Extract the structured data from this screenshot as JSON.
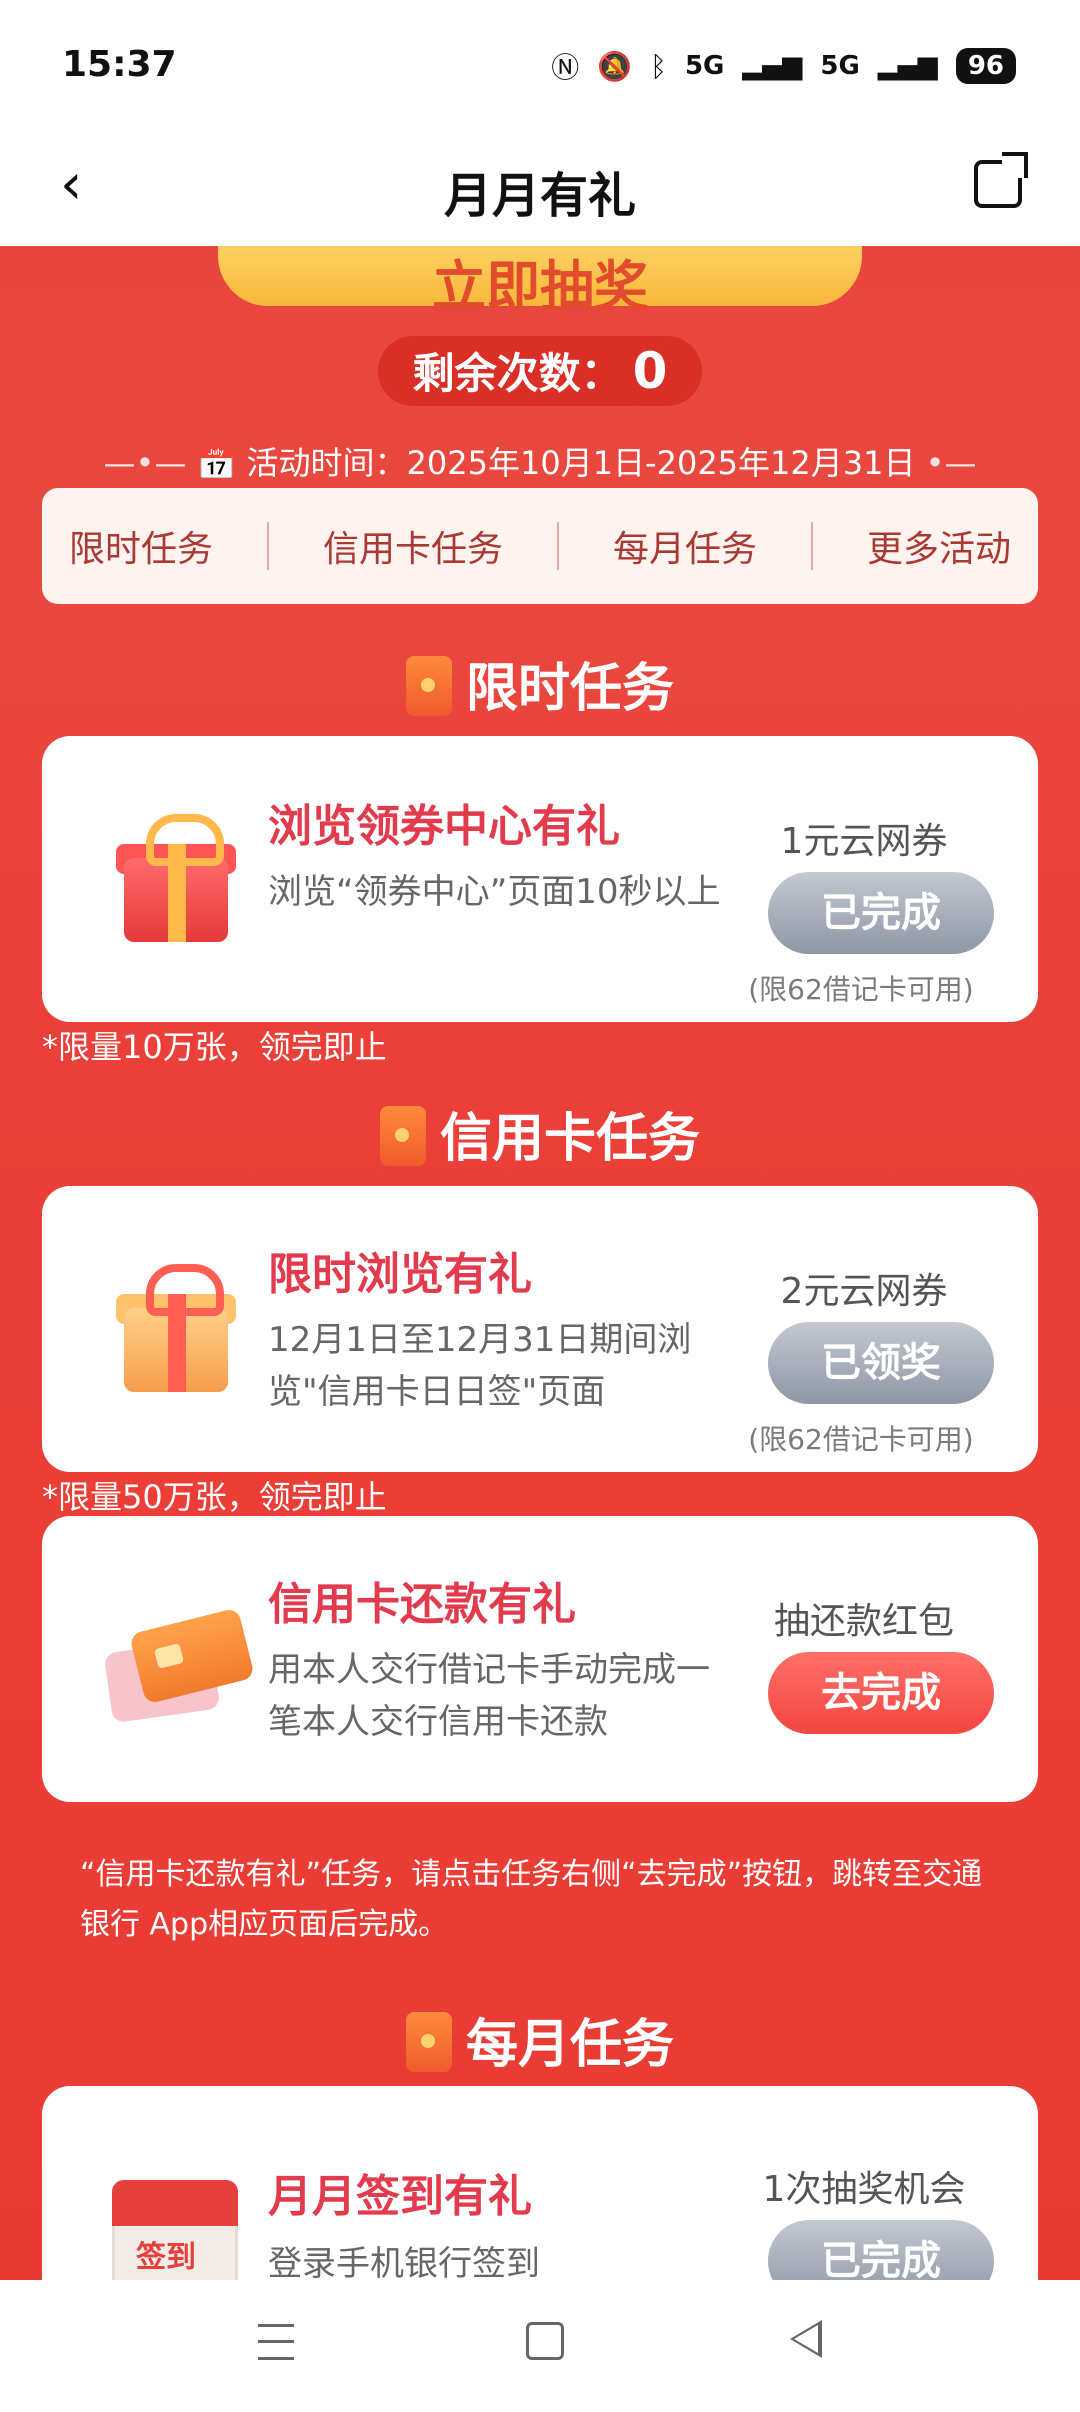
{
  "status_bar": {
    "time": "15:37",
    "icons": [
      "nfc-icon",
      "mute-icon",
      "bluetooth-icon"
    ],
    "signal1": "5G",
    "signal2": "5G",
    "battery": "96"
  },
  "nav": {
    "title": "月月有礼"
  },
  "banner": {
    "draw_label": "立即抽奖",
    "remaining_label": "剩余次数：",
    "remaining_count": "0",
    "period_label": "活动时间：",
    "period_value": "2025年10月1日-2025年12月31日"
  },
  "tabs": [
    "限时任务",
    "信用卡任务",
    "每月任务",
    "更多活动"
  ],
  "sections": {
    "limited": {
      "title": "限时任务",
      "task": {
        "title": "浏览领券中心有礼",
        "desc": "浏览“领券中心”页面10秒以上",
        "reward": "1元云网券",
        "button": "已完成",
        "limit": "(限62借记卡可用)"
      },
      "quota": "*限量10万张，领完即止"
    },
    "credit": {
      "title": "信用卡任务",
      "task1": {
        "title": "限时浏览有礼",
        "desc": "12月1日至12月31日期间浏览\"信用卡日日签\"页面",
        "reward": "2元云网券",
        "button": "已领奖",
        "limit": "(限62借记卡可用)"
      },
      "quota": "*限量50万张，领完即止",
      "task2": {
        "title": "信用卡还款有礼",
        "desc": "用本人交行借记卡手动完成一笔本人交行信用卡还款",
        "reward": "抽还款红包",
        "button": "去完成"
      },
      "note": "“信用卡还款有礼”任务，请点击任务右侧“去完成”按钮，跳转至交通银行 App相应页面后完成。"
    },
    "monthly": {
      "title": "每月任务",
      "task": {
        "title": "月月签到有礼",
        "desc": "登录手机银行签到",
        "reward": "1次抽奖机会",
        "button": "已完成",
        "icon_text": "签到"
      }
    }
  }
}
